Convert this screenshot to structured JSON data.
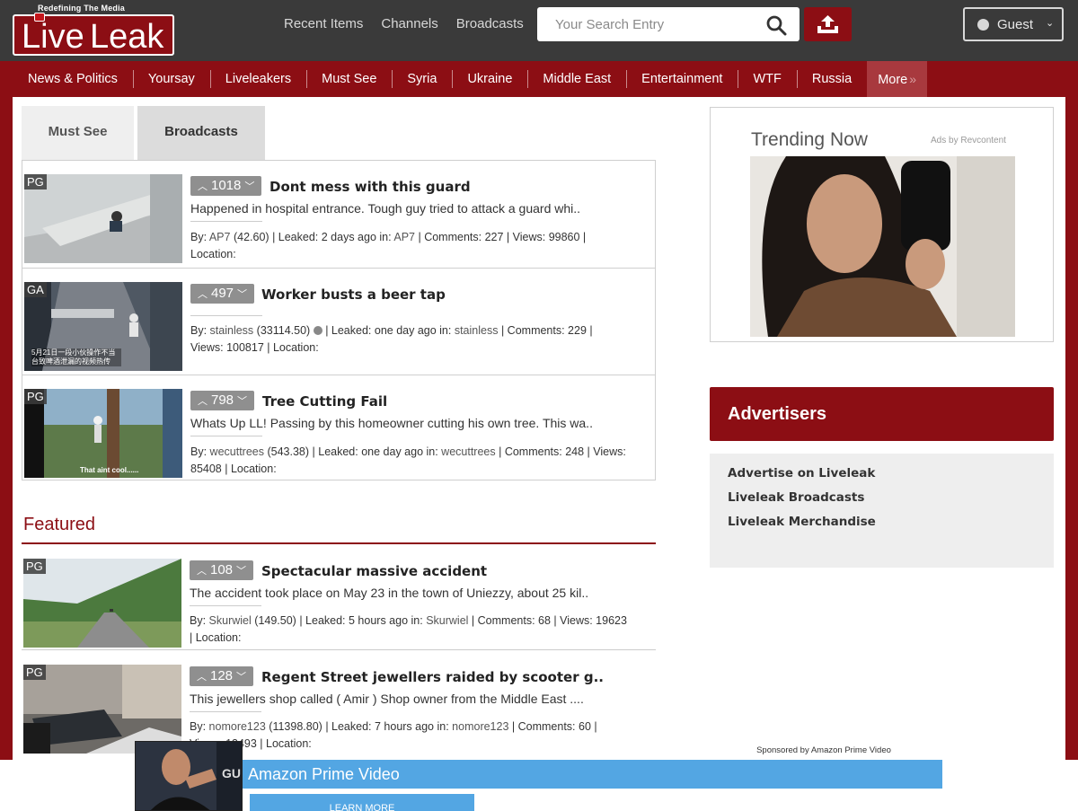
{
  "header": {
    "logo_tag": "Redefining The Media",
    "logo_live": "Live",
    "logo_leak": "Leak",
    "nav": [
      "Recent Items",
      "Channels",
      "Broadcasts"
    ],
    "search_placeholder": "Your Search Entry",
    "guest_label": "Guest"
  },
  "categories": [
    "News & Politics",
    "Yoursay",
    "Liveleakers",
    "Must See",
    "Syria",
    "Ukraine",
    "Middle East",
    "Entertainment",
    "WTF",
    "Russia",
    "More"
  ],
  "tabs": [
    "Must See",
    "Broadcasts"
  ],
  "items": [
    {
      "rating": "PG",
      "votes": "1018",
      "title": "Dont mess with this guard",
      "desc": "Happened in hospital entrance. Tough guy tried to attack a guard whi..",
      "meta_by": "By: ",
      "user": "AP7",
      "score": "(42.60)",
      "leaked": "| Leaked: 2 days ago in: ",
      "channel": "AP7",
      "stats": "| Comments: 227 | Views: 99860 |",
      "location": "Location:"
    },
    {
      "rating": "GA",
      "votes": "497",
      "title": "Worker busts a beer tap",
      "desc": "",
      "meta_by": "By: ",
      "user": "stainless",
      "score": "(33114.50)",
      "leaked": "| Leaked: one day ago in: ",
      "channel": "stainless",
      "stats": "| Comments: 229 |",
      "views": "Views: 100817 | Location:",
      "thumb_caption": "5月21日一段小伙操作不当 台致啤酒泄漏的视频热传"
    },
    {
      "rating": "PG",
      "votes": "798",
      "title": "Tree Cutting Fail",
      "desc": "Whats Up LL! Passing by this homeowner cutting his own tree. This wa..",
      "meta_by": "By: ",
      "user": "wecuttrees",
      "score": "(543.38)",
      "leaked": "| Leaked: one day ago in: ",
      "channel": "wecuttrees",
      "stats": "| Comments: 248 | Views:",
      "views": "85408 | Location:",
      "thumb_caption": "That aint cool......"
    }
  ],
  "featured": {
    "heading": "Featured",
    "items": [
      {
        "rating": "PG",
        "votes": "108",
        "title": "Spectacular massive accident",
        "desc": "The accident took place on May 23 in the town of Uniezzy, about 25 kil..",
        "meta_by": "By: ",
        "user": "Skurwiel",
        "score": "(149.50)",
        "leaked": "| Leaked: 5 hours ago in: ",
        "channel": "Skurwiel",
        "stats": "| Comments: 68 | Views: 19623",
        "views": "| Location:"
      },
      {
        "rating": "PG",
        "votes": "128",
        "title": "Regent Street jewellers raided by scooter g..",
        "desc": "This jewellers shop called ( Amir ) Shop owner from the Middle East ....",
        "meta_by": "By: ",
        "user": "nomore123",
        "score": "(11398.80)",
        "leaked": "| Leaked: 7 hours ago in: ",
        "channel": "nomore123",
        "stats": "| Comments: 60 |",
        "views": "Views: 13493 | Location:"
      }
    ]
  },
  "trending": {
    "heading": "Trending Now",
    "ads_by": "Ads by Revcontent"
  },
  "advertisers": {
    "heading": "Advertisers",
    "links": [
      "Advertise on Liveleak",
      "Liveleak Broadcasts",
      "Liveleak Merchandise"
    ]
  },
  "bottom_ad": {
    "sponsor": "Sponsored by Amazon Prime Video",
    "title": "Amazon Prime Video",
    "button": "LEARN MORE"
  },
  "colors": {
    "brand": "#8c0e14",
    "header_bg": "#3a3a3a",
    "ad_blue": "#53a6e3"
  }
}
